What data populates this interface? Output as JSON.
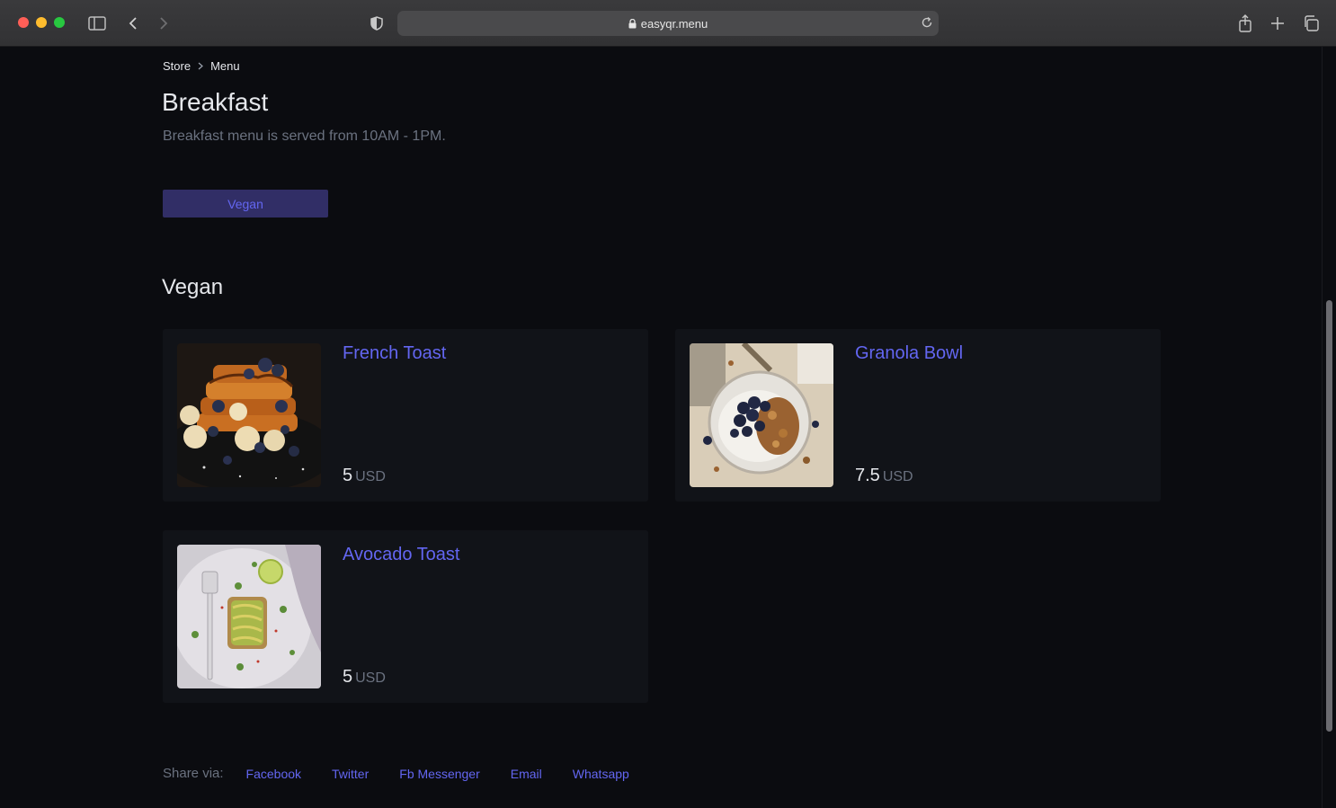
{
  "browser": {
    "url": "easyqr.menu"
  },
  "breadcrumb": {
    "items": [
      "Store",
      "Menu"
    ]
  },
  "page": {
    "title": "Breakfast",
    "subtitle": "Breakfast menu is served from 10AM - 1PM."
  },
  "filters": {
    "active_label": "Vegan"
  },
  "section": {
    "title": "Vegan"
  },
  "items": [
    {
      "name": "French Toast",
      "price": "5",
      "currency": "USD",
      "image": "french-toast-photo"
    },
    {
      "name": "Granola Bowl",
      "price": "7.5",
      "currency": "USD",
      "image": "granola-bowl-photo"
    },
    {
      "name": "Avocado Toast",
      "price": "5",
      "currency": "USD",
      "image": "avocado-toast-photo"
    }
  ],
  "share": {
    "label": "Share via:",
    "links": [
      "Facebook",
      "Twitter",
      "Fb Messenger",
      "Email",
      "Whatsapp"
    ]
  },
  "colors": {
    "accent": "#6366f1",
    "background": "#0b0c10",
    "card": "#111318",
    "filter_button": "#312e66"
  }
}
